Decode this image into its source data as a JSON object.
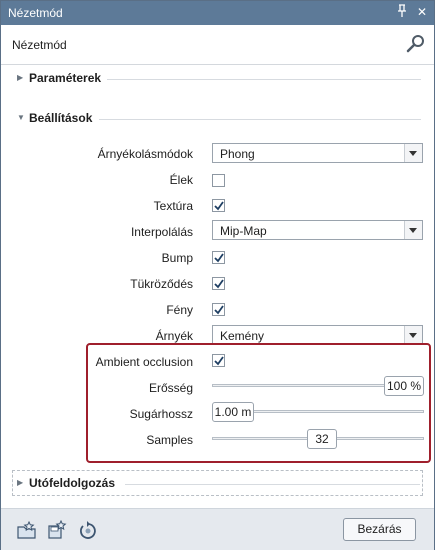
{
  "window": {
    "title": "Nézetmód",
    "pin_glyph": "⊥",
    "close_glyph": "✕"
  },
  "header": {
    "name": "Nézetmód",
    "search_icon": "search-icon"
  },
  "sections": {
    "parameters": {
      "label": "Paraméterek",
      "expanded": false
    },
    "settings": {
      "label": "Beállítások",
      "expanded": true
    },
    "post": {
      "label": "Utófeldolgozás",
      "expanded": false
    }
  },
  "settings": {
    "shading": {
      "label": "Árnyékolásmódok",
      "value": "Phong"
    },
    "edges": {
      "label": "Élek",
      "checked": false
    },
    "texture": {
      "label": "Textúra",
      "checked": true
    },
    "interpolation": {
      "label": "Interpolálás",
      "value": "Mip-Map"
    },
    "bump": {
      "label": "Bump",
      "checked": true
    },
    "reflection": {
      "label": "Tükröződés",
      "checked": true
    },
    "light": {
      "label": "Fény",
      "checked": true
    },
    "shadow": {
      "label": "Árnyék",
      "value": "Kemény"
    },
    "ambient_occlusion": {
      "label": "Ambient occlusion",
      "checked": true
    },
    "strength": {
      "label": "Erősség",
      "value": "100 %",
      "level": 1.0
    },
    "ray_length": {
      "label": "Sugárhossz",
      "value": "1.00 m",
      "level": 0.0
    },
    "samples": {
      "label": "Samples",
      "value": "32",
      "level": 0.52
    }
  },
  "footer": {
    "close_label": "Bezárás"
  },
  "colors": {
    "titlebar": "#5d7a98",
    "highlight": "#9f1f2c",
    "footer": "#e5e9ee"
  }
}
